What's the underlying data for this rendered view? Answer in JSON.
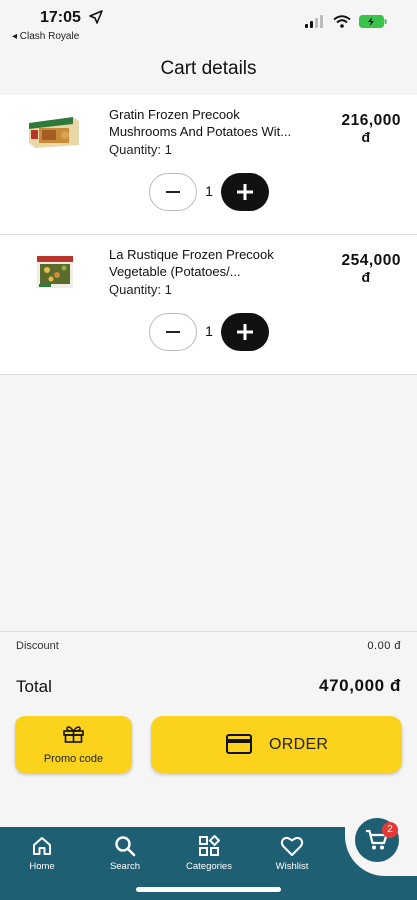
{
  "status_bar": {
    "time": "17:05",
    "back_app": "◂ Clash Royale"
  },
  "header": {
    "title": "Cart details"
  },
  "cart": {
    "items": [
      {
        "name_line1": "Gratin Frozen Precook",
        "name_line2": "Mushrooms And Potatoes Wit...",
        "quantity_text": "Quantity: 1",
        "price": "216,000",
        "currency": "đ",
        "qty": "1"
      },
      {
        "name_line1": "La Rustique Frozen Precook",
        "name_line2": "Vegetable (Potatoes/...",
        "quantity_text": "Quantity: 1",
        "price": "254,000",
        "currency": "đ",
        "qty": "1"
      }
    ]
  },
  "summary": {
    "discount_label": "Discount",
    "discount_value": "0.00 đ",
    "total_label": "Total",
    "total_value": "470,000 đ"
  },
  "actions": {
    "promo_label": "Promo code",
    "order_label": "ORDER"
  },
  "bottom_nav": {
    "items": [
      {
        "label": "Home",
        "icon": "home-icon"
      },
      {
        "label": "Search",
        "icon": "search-icon"
      },
      {
        "label": "Categories",
        "icon": "categories-icon"
      },
      {
        "label": "Wishlist",
        "icon": "heart-icon"
      }
    ],
    "cart_badge": "2"
  },
  "colors": {
    "accent_yellow": "#fbd31c",
    "nav_teal": "#1f5f73",
    "badge_red": "#e53935"
  }
}
